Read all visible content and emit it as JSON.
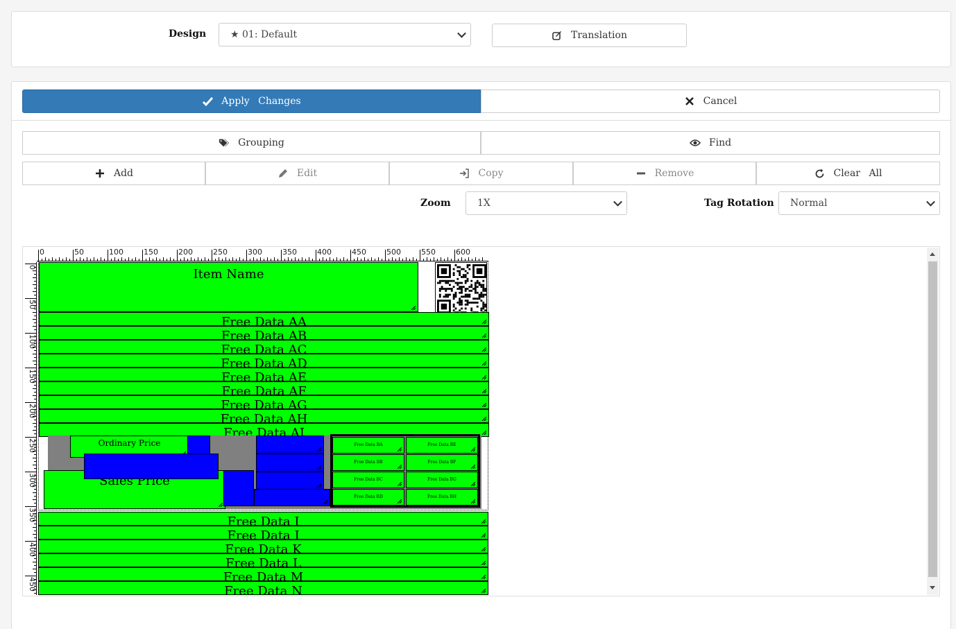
{
  "header": {
    "design_label": "Design",
    "design_value": "★ 01: Default",
    "translation_label": "Translation"
  },
  "actions": {
    "apply_label": "Apply Changes",
    "cancel_label": "Cancel"
  },
  "tools": {
    "grouping_label": "Grouping",
    "find_label": "Find",
    "add_label": "Add",
    "edit_label": "Edit",
    "copy_label": "Copy",
    "remove_label": "Remove",
    "clear_label": "Clear All"
  },
  "options": {
    "zoom_label": "Zoom",
    "zoom_value": "1X",
    "rotation_label": "Tag Rotation",
    "rotation_value": "Normal"
  },
  "ruler": {
    "h_ticks": [
      "0",
      "50",
      "100",
      "150",
      "200",
      "250",
      "300",
      "350",
      "400",
      "450",
      "500",
      "550",
      "600"
    ],
    "v_ticks": [
      "0",
      "50",
      "100",
      "150",
      "200",
      "250",
      "300",
      "350",
      "400",
      "450"
    ]
  },
  "tag": {
    "item_name": "Item Name",
    "free_rows_top": [
      "Free Data AA",
      "Free Data AB",
      "Free Data AC",
      "Free Data AD",
      "Free Data AE",
      "Free Data AF",
      "Free Data AG",
      "Free Data AH",
      "Free Data AI"
    ],
    "ordinary_price": "Ordinary Price",
    "sales_price": "Sales Price",
    "grid_b_left": [
      "Free Data BA",
      "Free Data BB",
      "Free Data BC",
      "Free Data BD"
    ],
    "grid_b_right": [
      "Free Data BE",
      "Free Data BF",
      "Free Data BG",
      "Free Data BH"
    ],
    "free_rows_bottom": [
      "Free Data I",
      "Free Data J",
      "Free Data K",
      "Free Data L",
      "Free Data M",
      "Free Data N"
    ]
  },
  "colors": {
    "primary": "#337ab7",
    "field_green": "#00ff00",
    "field_blue": "#0000ff",
    "group_gray": "#808080"
  }
}
